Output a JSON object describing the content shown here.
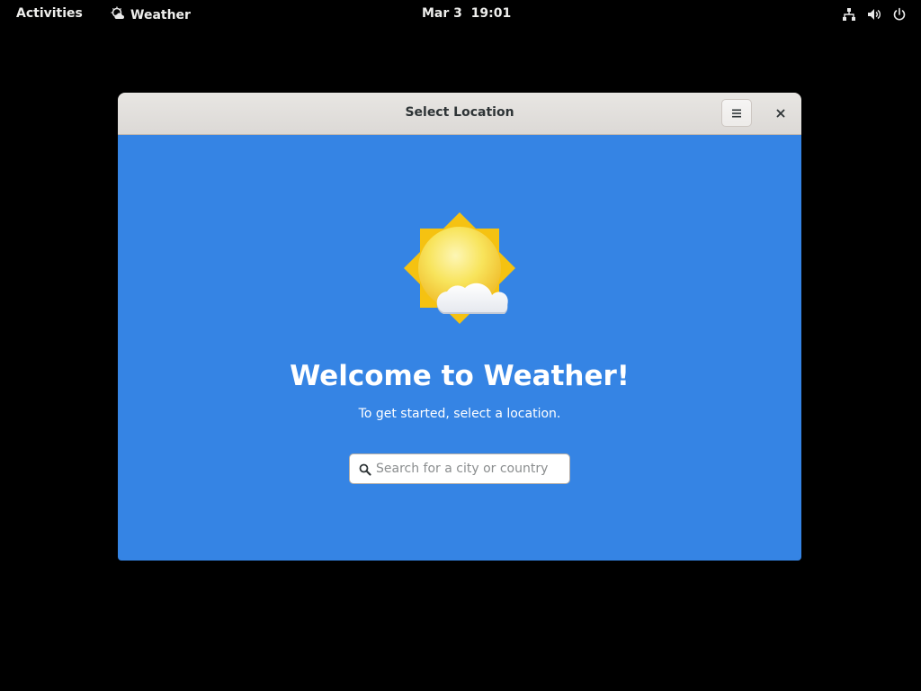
{
  "topbar": {
    "activities_label": "Activities",
    "app_name": "Weather",
    "clock": "Mar 3  19:01",
    "status_icons": [
      "network-wired-icon",
      "volume-icon",
      "power-icon"
    ]
  },
  "window": {
    "title": "Select Location",
    "menu_icon": "hamburger-menu-icon",
    "close_icon": "close-icon"
  },
  "welcome": {
    "illustration_icon": "weather-few-clouds-icon",
    "title": "Welcome to Weather!",
    "subtitle": "To get started, select a location."
  },
  "search": {
    "placeholder": "Search for a city or country",
    "value": ""
  },
  "colors": {
    "accent_blue": "#3584e4",
    "headerbar": "#e8e6e3",
    "sun_yellow": "#f6d32d"
  }
}
